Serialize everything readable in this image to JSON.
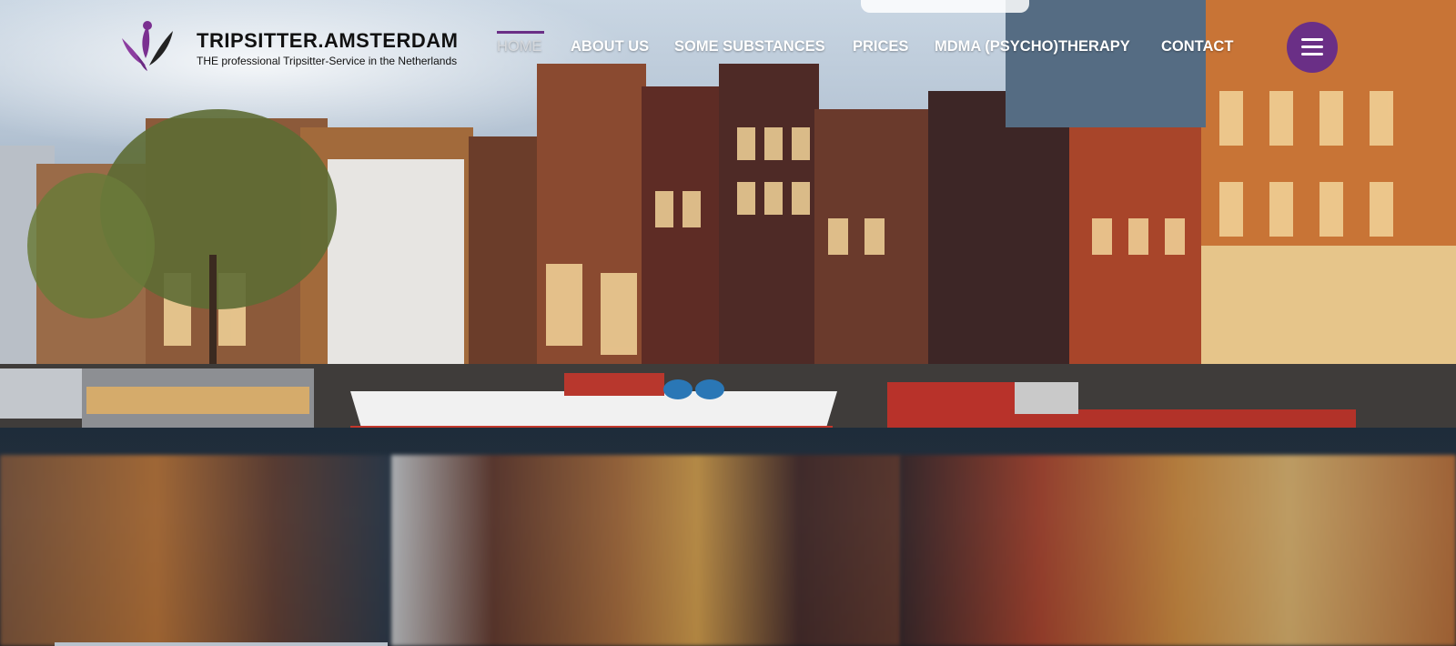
{
  "brand": {
    "title": "TRIPSITTER.AMSTERDAM",
    "subtitle": "THE professional Tripsitter-Service in the Netherlands",
    "logo_icon": "lotus-person-logo",
    "accent": "#6a2f86"
  },
  "nav": {
    "items": [
      {
        "label": "HOME",
        "active": true
      },
      {
        "label": "ABOUT US"
      },
      {
        "label": "SOME SUBSTANCES"
      },
      {
        "label": "PRICES"
      },
      {
        "label": "MDMA (PSYCHO)THERAPY"
      },
      {
        "label": "CONTACT"
      }
    ],
    "menu_icon": "hamburger-menu-icon"
  },
  "hero": {
    "image": "Amsterdam canal houses at dusk reflected in water"
  }
}
